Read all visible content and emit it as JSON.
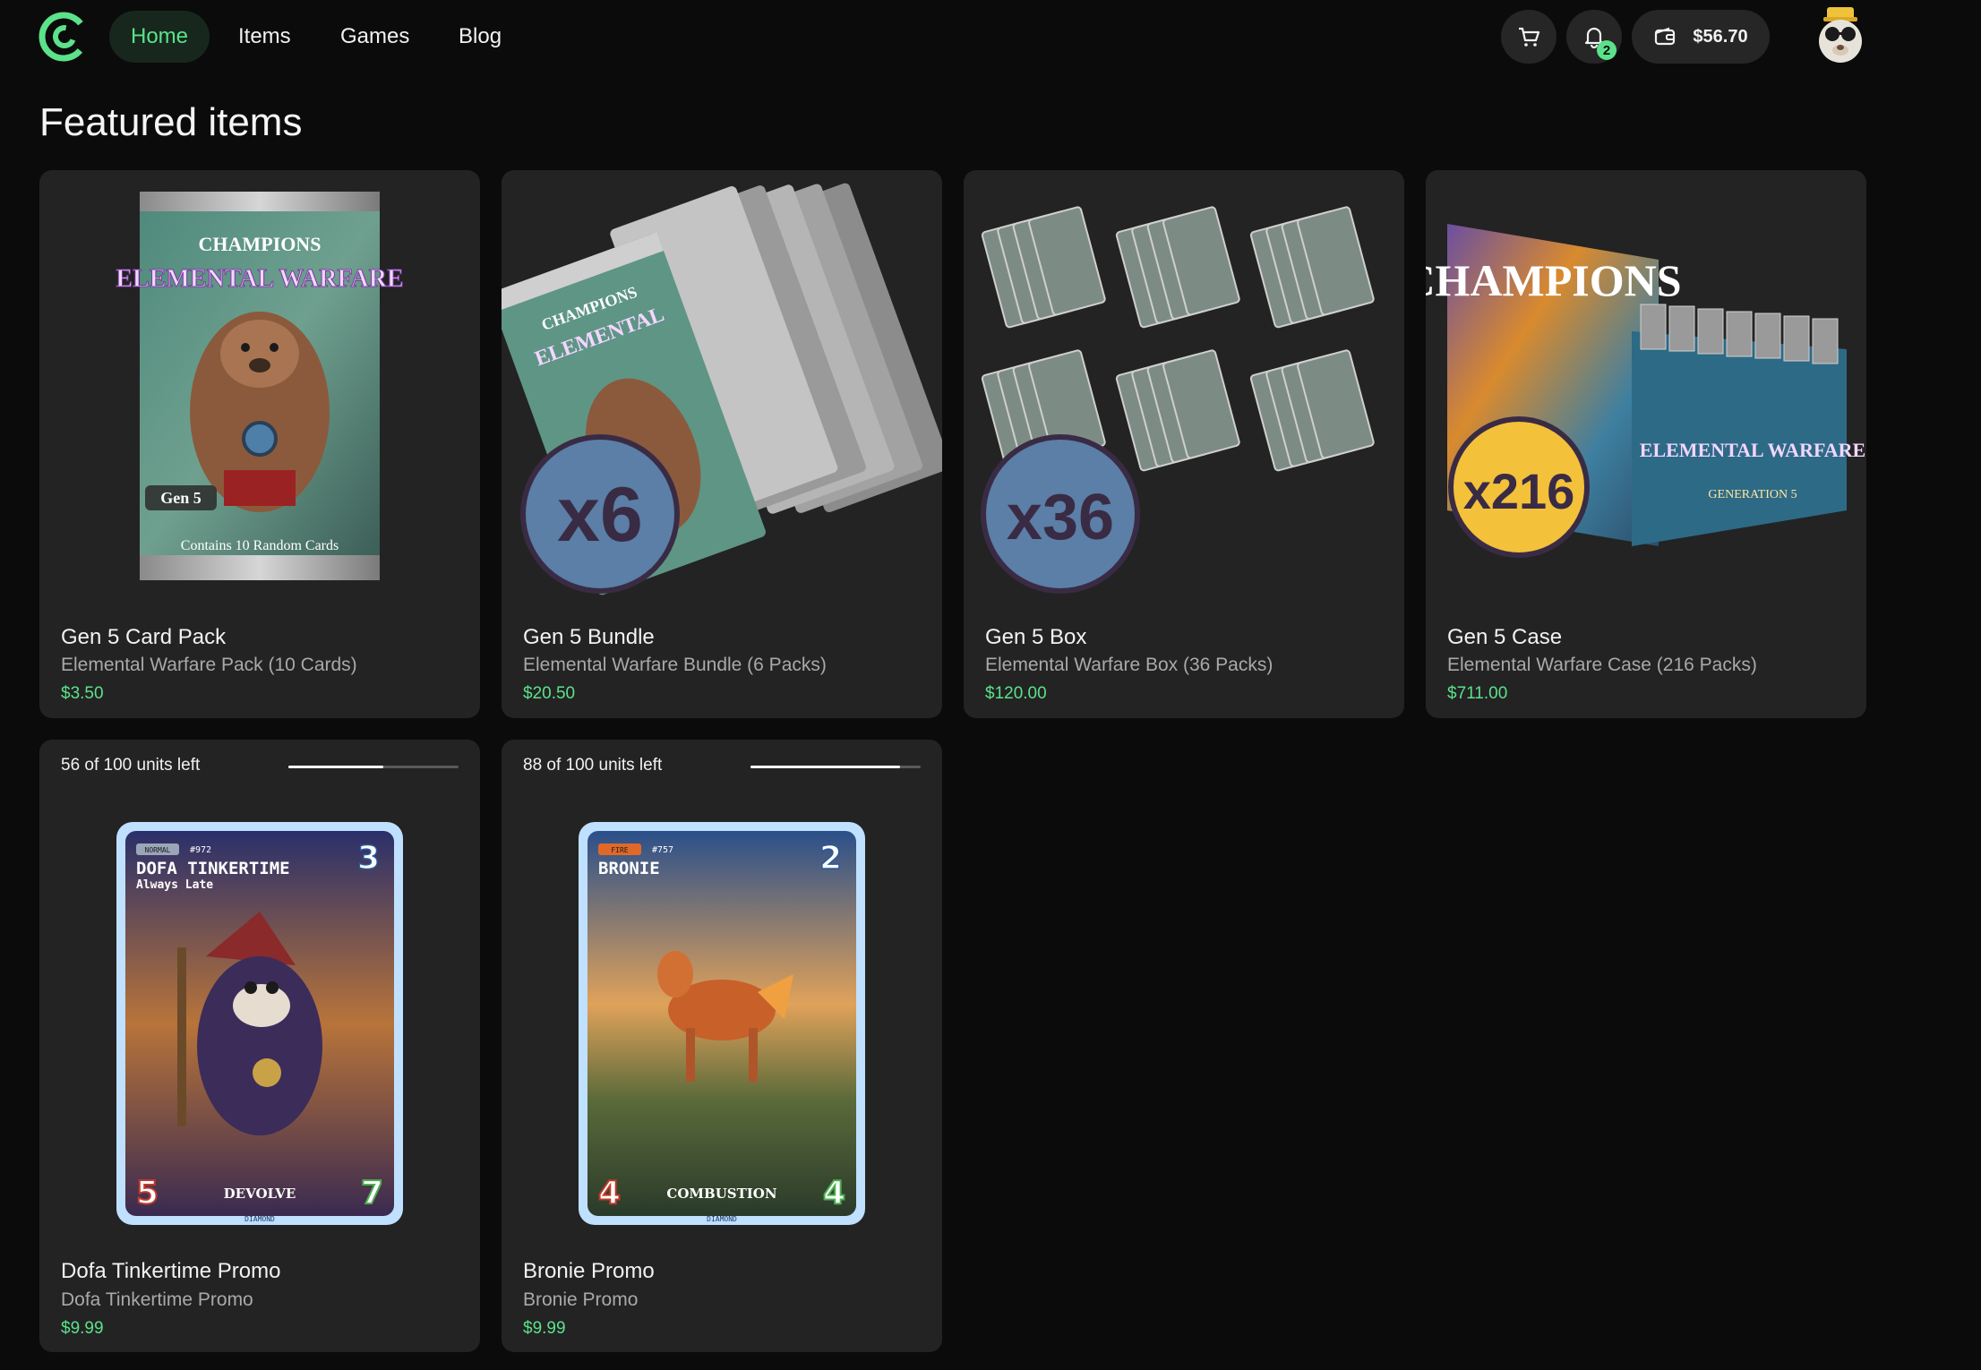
{
  "nav": {
    "links": [
      {
        "label": "Home"
      },
      {
        "label": "Items"
      },
      {
        "label": "Games"
      },
      {
        "label": "Blog"
      }
    ],
    "notifications_count": "2",
    "wallet_balance": "$56.70",
    "accent": "#5be28a"
  },
  "page_title": "Featured items",
  "products": [
    {
      "name": "Gen 5 Card Pack",
      "subtitle": "Elemental Warfare Pack (10 Cards)",
      "price": "$3.50",
      "art_title": "ELEMENTAL WARFARE",
      "art_brand": "CHAMPIONS",
      "art_gen": "Gen 5",
      "art_footer": "Contains 10 Random Cards"
    },
    {
      "name": "Gen 5 Bundle",
      "subtitle": "Elemental Warfare Bundle (6 Packs)",
      "price": "$20.50",
      "multiplier": "x6"
    },
    {
      "name": "Gen 5 Box",
      "subtitle": "Elemental Warfare Box (36 Packs)",
      "price": "$120.00",
      "multiplier": "x36"
    },
    {
      "name": "Gen 5 Case",
      "subtitle": "Elemental Warfare Case (216 Packs)",
      "price": "$711.00",
      "multiplier": "x216",
      "art_brand": "CHAMPIONS",
      "art_title": "ELEMENTAL WARFARE",
      "art_gen": "GENERATION 5"
    }
  ],
  "promos": [
    {
      "stock_label": "56 of 100 units left",
      "stock_fraction": 0.56,
      "name": "Dofa Tinkertime Promo",
      "subtitle": "Dofa Tinkertime Promo",
      "price": "$9.99",
      "card": {
        "type": "NORMAL",
        "number": "#972",
        "title": "DOFA TINKERTIME",
        "tagline": "Always Late",
        "cost": "3",
        "attack": "5",
        "ability": "DEVOLVE",
        "health": "7",
        "rarity": "DIAMOND"
      }
    },
    {
      "stock_label": "88 of 100 units left",
      "stock_fraction": 0.88,
      "name": "Bronie Promo",
      "subtitle": "Bronie Promo",
      "price": "$9.99",
      "card": {
        "type": "FIRE",
        "number": "#757",
        "title": "BRONIE",
        "tagline": "",
        "cost": "2",
        "attack": "4",
        "ability": "COMBUSTION",
        "health": "4",
        "rarity": "DIAMOND"
      }
    }
  ]
}
